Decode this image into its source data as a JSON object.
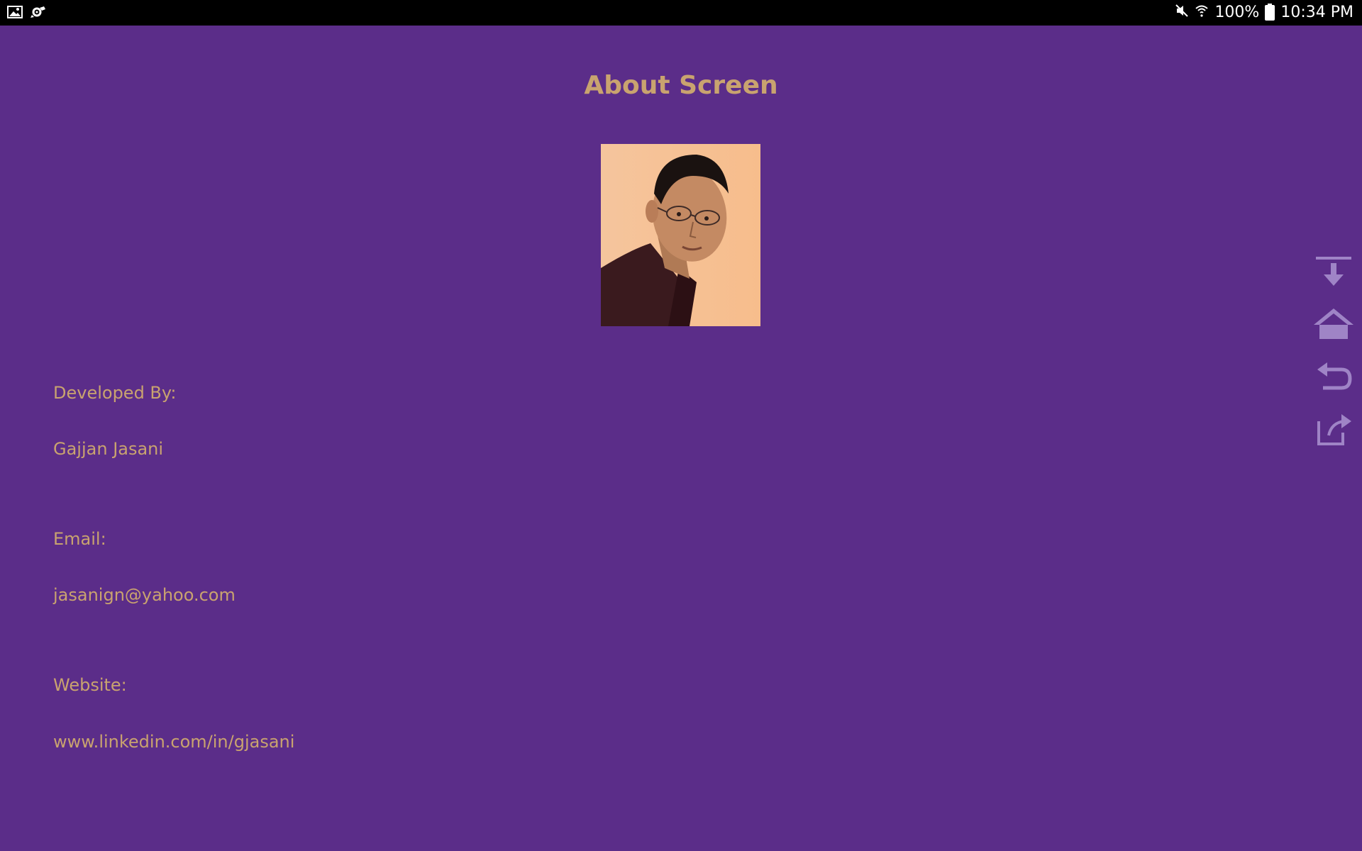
{
  "status_bar": {
    "icons_left": [
      "image-icon",
      "settings-gear-icon"
    ],
    "battery_percent": "100%",
    "time": "10:34 PM",
    "icons_right": [
      "mute-icon",
      "wifi-icon",
      "battery-icon"
    ]
  },
  "screen": {
    "title": "About Screen",
    "profile_photo": "developer-photo"
  },
  "info": {
    "developed_by_label": "Developed By:",
    "developer_name": "Gajjan Jasani",
    "email_label": "Email:",
    "email_value": "jasanign@yahoo.com",
    "website_label": "Website:",
    "website_value": "www.linkedin.com/in/gjasani"
  },
  "side_controls": [
    "download-icon",
    "home-icon",
    "undo-icon",
    "share-icon"
  ],
  "colors": {
    "background": "#5b2d89",
    "text": "#c9a36f",
    "status_bar": "#000000",
    "control_icon": "#9f84c6"
  }
}
